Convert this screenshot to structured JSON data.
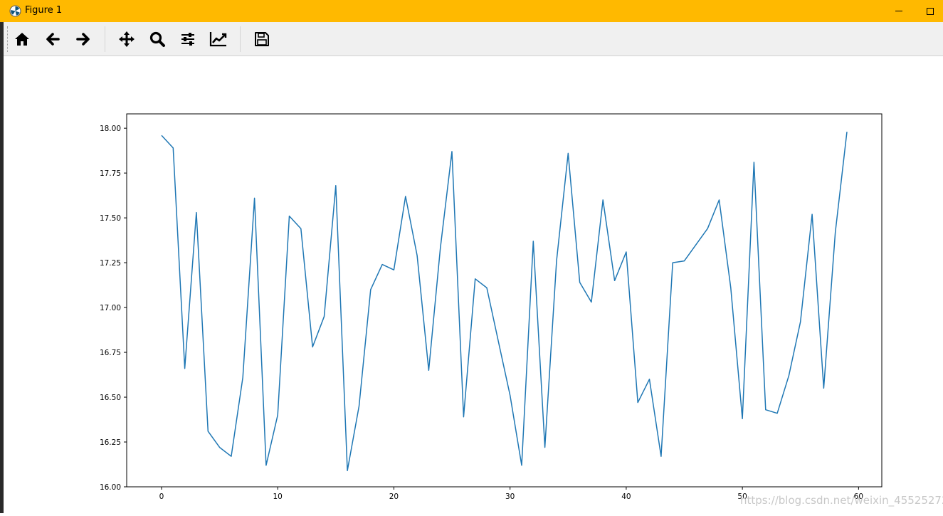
{
  "window": {
    "title": "Figure 1",
    "accent_color": "#ffb900",
    "app_icon": "matplotlib-icon",
    "controls": [
      "minimize-icon",
      "maximize-icon"
    ]
  },
  "toolbar": {
    "buttons": [
      {
        "name": "home",
        "icon": "home-icon"
      },
      {
        "name": "back",
        "icon": "arrow-left-icon"
      },
      {
        "name": "forward",
        "icon": "arrow-right-icon"
      },
      {
        "name": "pan",
        "icon": "move-icon"
      },
      {
        "name": "zoom",
        "icon": "magnifier-icon"
      },
      {
        "name": "configure-subplots",
        "icon": "sliders-icon"
      },
      {
        "name": "edit-axis",
        "icon": "chart-line-icon"
      },
      {
        "name": "save",
        "icon": "floppy-disk-icon"
      }
    ]
  },
  "chart_data": {
    "type": "line",
    "title": "",
    "xlabel": "",
    "ylabel": "",
    "xlim": [
      -3,
      62
    ],
    "ylim": [
      16.0,
      18.08
    ],
    "x_ticks": [
      0,
      10,
      20,
      30,
      40,
      50,
      60
    ],
    "y_ticks": [
      16.0,
      16.25,
      16.5,
      16.75,
      17.0,
      17.25,
      17.5,
      17.75,
      18.0
    ],
    "x_tick_labels": [
      "0",
      "10",
      "20",
      "30",
      "40",
      "50",
      "60"
    ],
    "y_tick_labels": [
      "16.00",
      "16.25",
      "16.50",
      "16.75",
      "17.00",
      "17.25",
      "17.50",
      "17.75",
      "18.00"
    ],
    "grid": false,
    "line_color": "#1f77b4",
    "series": [
      {
        "x": [
          0,
          1,
          2,
          3,
          4,
          5,
          6,
          7,
          8,
          9,
          10,
          11,
          12,
          13,
          14,
          15,
          16,
          17,
          18,
          19,
          20,
          21,
          22,
          23,
          24,
          25,
          26,
          27,
          28,
          29,
          30,
          31,
          32,
          33,
          34,
          35,
          36,
          37,
          38,
          39,
          40,
          41,
          42,
          43,
          44,
          45,
          46,
          47,
          48,
          49,
          50,
          51,
          52,
          53,
          54,
          55,
          56,
          57,
          58,
          59
        ],
        "values": [
          17.96,
          17.89,
          16.66,
          17.53,
          16.31,
          16.22,
          16.17,
          16.61,
          17.61,
          16.12,
          16.4,
          17.51,
          17.44,
          16.78,
          16.95,
          17.68,
          16.09,
          16.45,
          17.1,
          17.24,
          17.21,
          17.62,
          17.29,
          16.65,
          17.33,
          17.87,
          16.39,
          17.16,
          17.11,
          16.81,
          16.51,
          16.12,
          17.37,
          16.22,
          17.26,
          17.86,
          17.14,
          17.03,
          17.6,
          17.15,
          17.31,
          16.47,
          16.6,
          16.17,
          17.25,
          17.26,
          17.35,
          17.44,
          17.6,
          17.11,
          16.38,
          17.81,
          16.43,
          16.41,
          16.62,
          16.92,
          17.52,
          16.55,
          17.42,
          17.98
        ]
      }
    ]
  },
  "watermark": "https://blog.csdn.net/weixin_45525272"
}
